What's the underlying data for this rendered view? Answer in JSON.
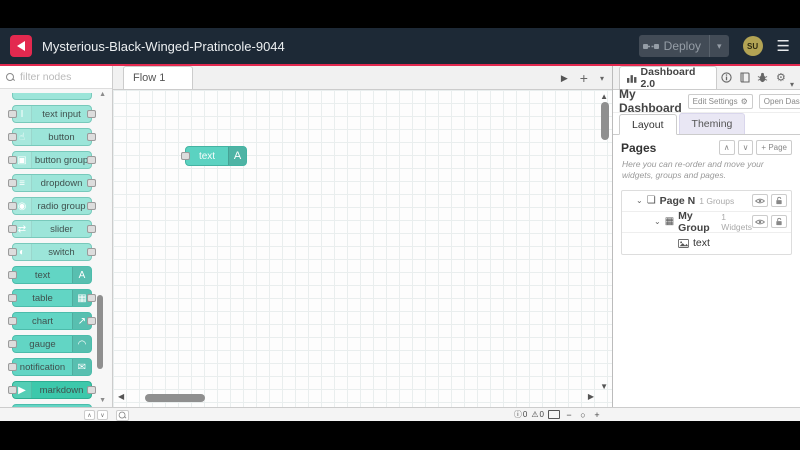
{
  "colors": {
    "header_bg": "#1d2936",
    "accent_red": "#e3294f",
    "node_teal_light": "#9ce5d9",
    "node_teal_dark": "#62d5c4",
    "node_markdown": "#3cc8ab",
    "avatar_bg": "#b2a354",
    "inactive_tab_lavender": "#e9e7f4"
  },
  "header": {
    "title": "Mysterious-Black-Winged-Pratincole-9044",
    "deploy_label": "Deploy",
    "avatar_text": "SU"
  },
  "palette": {
    "filter_placeholder": "filter nodes",
    "nodes": [
      {
        "label": "",
        "icon": "",
        "variant": "light",
        "icon_side": "left",
        "ports": "none",
        "clip": "top"
      },
      {
        "label": "text input",
        "icon": "I",
        "variant": "light",
        "icon_side": "left",
        "ports": "both"
      },
      {
        "label": "button",
        "icon": "☝",
        "variant": "light",
        "icon_side": "left",
        "ports": "both"
      },
      {
        "label": "button group",
        "icon": "▣",
        "variant": "light",
        "icon_side": "left",
        "ports": "both"
      },
      {
        "label": "dropdown",
        "icon": "≡",
        "variant": "light",
        "icon_side": "left",
        "ports": "both"
      },
      {
        "label": "radio group",
        "icon": "◉",
        "variant": "light",
        "icon_side": "left",
        "ports": "both"
      },
      {
        "label": "slider",
        "icon": "⇄",
        "variant": "light",
        "icon_side": "left",
        "ports": "both"
      },
      {
        "label": "switch",
        "icon": "◐",
        "variant": "light",
        "icon_side": "left",
        "ports": "both"
      },
      {
        "label": "text",
        "icon": "A",
        "variant": "dark",
        "icon_side": "right",
        "ports": "left"
      },
      {
        "label": "table",
        "icon": "▦",
        "variant": "dark",
        "icon_side": "right",
        "ports": "both"
      },
      {
        "label": "chart",
        "icon": "↗",
        "variant": "dark",
        "icon_side": "right",
        "ports": "both"
      },
      {
        "label": "gauge",
        "icon": "◠",
        "variant": "dark",
        "icon_side": "right",
        "ports": "left"
      },
      {
        "label": "notification",
        "icon": "✉",
        "variant": "dark",
        "icon_side": "right",
        "ports": "left"
      },
      {
        "label": "markdown",
        "icon": "▶",
        "variant": "deep",
        "icon_side": "left",
        "ports": "both"
      },
      {
        "label": "",
        "icon": "",
        "variant": "dark",
        "icon_side": "left",
        "ports": "both",
        "clip": "bottom"
      }
    ]
  },
  "workspace": {
    "flow_tab_label": "Flow 1",
    "canvas_node": {
      "label": "text",
      "icon": "A"
    }
  },
  "footer": {
    "info_count": "0",
    "warning_count": "0"
  },
  "sidebar": {
    "tab_label": "Dashboard 2.0",
    "dashboard": {
      "title": "My Dashboard",
      "edit_settings_label": "Edit Settings",
      "open_dashboard_label": "Open Dashboard"
    },
    "tabs": {
      "layout": "Layout",
      "theming": "Theming"
    },
    "pages": {
      "heading": "Pages",
      "add_page_label": "+ Page",
      "description": "Here you can re-order and move your widgets, groups and pages."
    },
    "tree": {
      "page": {
        "name": "Page N",
        "count": "1 Groups"
      },
      "group": {
        "name": "My Group",
        "count": "1 Widgets"
      },
      "widget": {
        "name": "text"
      }
    }
  },
  "icons": {
    "hamburger": "☰",
    "chevron_down": "▾",
    "scroll_up": "▲",
    "scroll_down": "▼",
    "scroll_left": "◀",
    "scroll_right": "▶",
    "plus": "+",
    "minus": "−",
    "zoom_reset": "○",
    "info_circle": "ⓘ",
    "warning": "⚠",
    "gear": "⚙",
    "external_link": "↗",
    "caret_open": "⌄",
    "up": "∧",
    "down": "∨",
    "page": "❏",
    "group": "▦"
  }
}
